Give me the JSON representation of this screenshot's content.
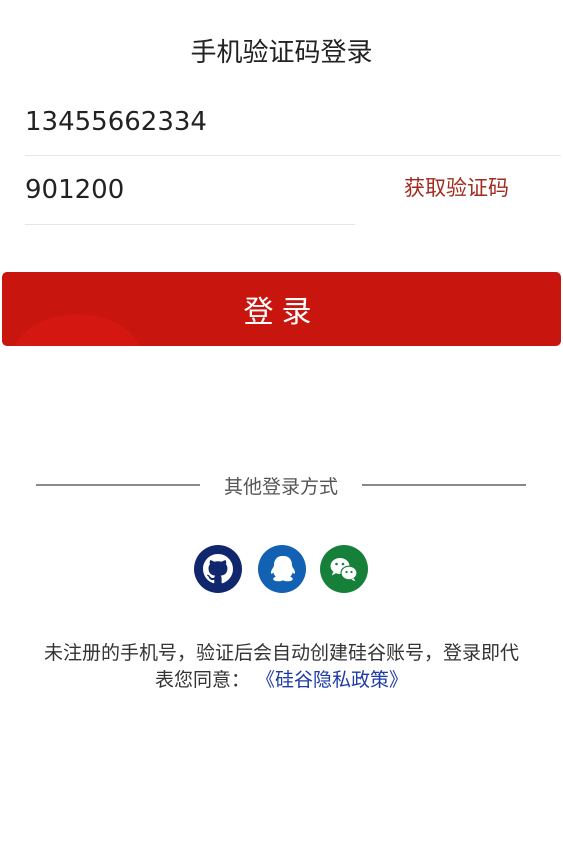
{
  "header": {
    "title": "手机验证码登录"
  },
  "form": {
    "phone_value": "13455662334",
    "code_value": "901200",
    "get_code_label": "获取验证码",
    "login_label": "登录"
  },
  "other_login": {
    "label": "其他登录方式",
    "providers": [
      {
        "name": "github-icon",
        "color": "#10266d"
      },
      {
        "name": "qq-icon",
        "color": "#1261b2"
      },
      {
        "name": "wechat-icon",
        "color": "#16803b"
      }
    ]
  },
  "footer": {
    "notice_line1": "未注册的手机号，验证后会自动创建硅谷账号，登录即代",
    "notice_line2": "表您同意：",
    "policy_link": "《硅谷隐私政策》"
  }
}
